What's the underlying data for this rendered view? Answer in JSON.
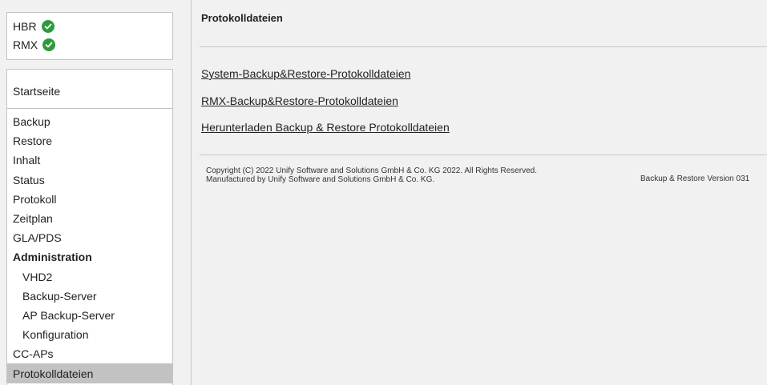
{
  "status": {
    "items": [
      {
        "label": "HBR",
        "icon": "check-circle-icon"
      },
      {
        "label": "RMX",
        "icon": "check-circle-icon"
      }
    ],
    "ok_color": "#2e9a3c"
  },
  "nav": {
    "home": "Startseite",
    "items": [
      {
        "label": "Backup"
      },
      {
        "label": "Restore"
      },
      {
        "label": "Inhalt"
      },
      {
        "label": "Status"
      },
      {
        "label": "Protokoll"
      },
      {
        "label": "Zeitplan"
      },
      {
        "label": "GLA/PDS"
      },
      {
        "label": "Administration"
      },
      {
        "label": "VHD2"
      },
      {
        "label": "Backup-Server"
      },
      {
        "label": "AP Backup-Server"
      },
      {
        "label": "Konfiguration"
      },
      {
        "label": "CC-APs"
      },
      {
        "label": "Protokolldateien"
      }
    ]
  },
  "main": {
    "title": "Protokolldateien",
    "links": [
      "System-Backup&Restore-Protokolldateien",
      "RMX-Backup&Restore-Protokolldateien",
      "Herunterladen Backup & Restore Protokolldateien"
    ]
  },
  "footer": {
    "copyright_line1": "Copyright (C) 2022 Unify Software and Solutions GmbH & Co. KG 2022. All Rights Reserved.",
    "copyright_line2": "Manufactured by Unify Software and Solutions GmbH & Co. KG.",
    "version": "Backup & Restore Version 031"
  }
}
